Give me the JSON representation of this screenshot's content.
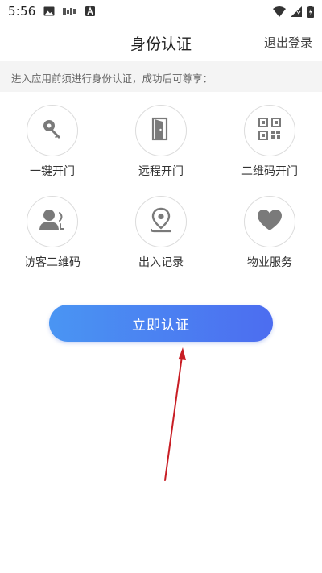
{
  "status_bar": {
    "time": "5:56",
    "icons": [
      "image-icon",
      "data-saver-icon",
      "font-icon",
      "wifi-icon",
      "signal-icon",
      "battery-icon"
    ]
  },
  "nav": {
    "title": "身份认证",
    "logout_label": "退出登录"
  },
  "notice": {
    "text": "进入应用前须进行身份认证，成功后可尊享："
  },
  "features": [
    {
      "label": "一键开门",
      "icon": "key-icon"
    },
    {
      "label": "远程开门",
      "icon": "door-icon"
    },
    {
      "label": "二维码开门",
      "icon": "qr-code-icon"
    },
    {
      "label": "访客二维码",
      "icon": "visitor-icon"
    },
    {
      "label": "出入记录",
      "icon": "location-pin-icon"
    },
    {
      "label": "物业服务",
      "icon": "heart-icon"
    }
  ],
  "cta": {
    "label": "立即认证"
  },
  "colors": {
    "accent_start": "#4a95f3",
    "accent_end": "#4c6df0",
    "icon_gray": "#7a7a7a",
    "annotation_arrow": "#c81d24"
  }
}
